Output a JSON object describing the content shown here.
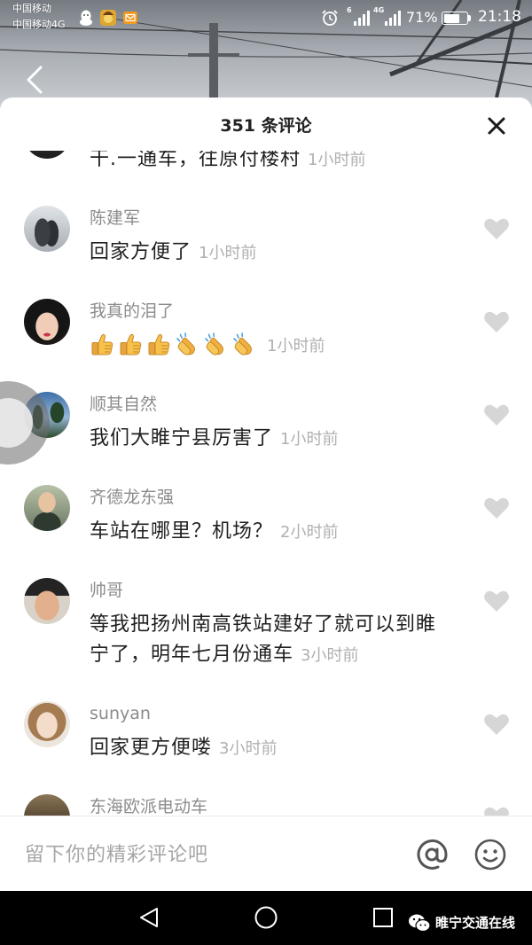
{
  "status_bar": {
    "carrier_primary": "中国移动",
    "carrier_secondary": "中国移动4G",
    "notification_icons": [
      "qq-icon",
      "photo-app-icon",
      "mail-icon"
    ],
    "alarm_icon": "alarm-clock-icon",
    "signal_primary_label": "6",
    "signal_secondary_label": "4G",
    "battery_percent": "71%",
    "battery_level": 0.71,
    "time": "21:18"
  },
  "top_bar": {
    "back_icon": "chevron-left-icon"
  },
  "sheet": {
    "title": "351 条评论",
    "close_icon": "close-icon"
  },
  "comment_list": {
    "like_icon": "heart-icon",
    "items": [
      {
        "text": "干.一通车，往原付楼村",
        "time": "1小时前"
      },
      {
        "name": "陈建军",
        "text": "回家方便了",
        "time": "1小时前"
      },
      {
        "name": "我真的泪了",
        "emoji_icons": [
          "thumbs-up-icon",
          "thumbs-up-icon",
          "thumbs-up-icon",
          "clapping-hands-icon",
          "clapping-hands-icon",
          "clapping-hands-icon"
        ],
        "time": "1小时前"
      },
      {
        "name": "顺其自然",
        "text": "我们大睢宁县厉害了",
        "time": "1小时前"
      },
      {
        "name": "齐德龙东强",
        "text": "车站在哪里？机场？",
        "time": "2小时前"
      },
      {
        "name": "帅哥",
        "text": "等我把扬州南高铁站建好了就可以到睢宁了，明年七月份通车",
        "time": "3小时前"
      },
      {
        "name": "sunyan",
        "text": "回家更方便喽",
        "time": "3小时前"
      },
      {
        "name": "东海欧派电动车"
      }
    ]
  },
  "composer": {
    "placeholder": "留下你的精彩评论吧",
    "mention_icon": "at-icon",
    "emoji_icon": "smiley-icon"
  },
  "system_nav": {
    "back_icon": "back-triangle-icon",
    "home_icon": "home-circle-icon",
    "recents_icon": "recents-square-icon"
  },
  "watermark": {
    "icon": "wechat-icon",
    "text": "睢宁交通在线"
  },
  "colors": {
    "sheet_background": "#ffffff",
    "author_name": "#8c8c8c",
    "comment_text": "#1f1f1f",
    "timestamp": "#b0b0b0",
    "like_heart": "#d6d6d6",
    "placeholder": "#a6a6a6",
    "system_nav": "#000000"
  }
}
